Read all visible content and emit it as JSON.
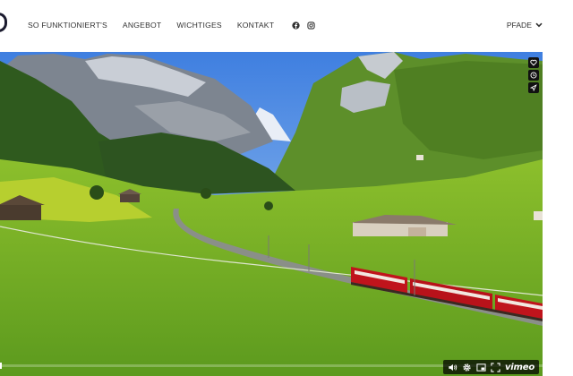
{
  "nav": {
    "items": [
      "SO FUNKTIONIERT'S",
      "ANGEBOT",
      "WICHTIGES",
      "KONTAKT"
    ],
    "social_icons": [
      "facebook-icon",
      "instagram-icon"
    ],
    "dropdown_label": "PFADE"
  },
  "video": {
    "provider_label": "vimeo",
    "side_icons": [
      "heart-icon",
      "clock-icon",
      "share-icon"
    ],
    "control_icons": [
      "volume-icon",
      "settings-icon",
      "pip-icon",
      "fullscreen-icon"
    ],
    "progress": 0.0
  },
  "colors": {
    "text": "#333333",
    "logo": "#1a1a2e",
    "control_bg": "#111111",
    "train": "#c0141c"
  }
}
